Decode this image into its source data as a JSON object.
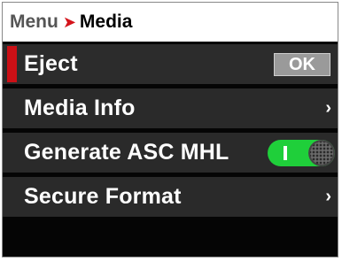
{
  "breadcrumb": {
    "root": "Menu",
    "separator": "➤",
    "current": "Media"
  },
  "items": [
    {
      "label": "Eject",
      "control": "button",
      "button_label": "OK",
      "selected": true
    },
    {
      "label": "Media Info",
      "control": "submenu",
      "chevron": "›"
    },
    {
      "label": "Generate ASC MHL",
      "control": "toggle",
      "toggle_on": true
    },
    {
      "label": "Secure Format",
      "control": "submenu",
      "chevron": "›"
    }
  ],
  "colors": {
    "accent": "#cc1016",
    "toggle_on": "#1fcf3a",
    "row_bg": "#2a2a2a",
    "screen_bg": "#050505"
  }
}
